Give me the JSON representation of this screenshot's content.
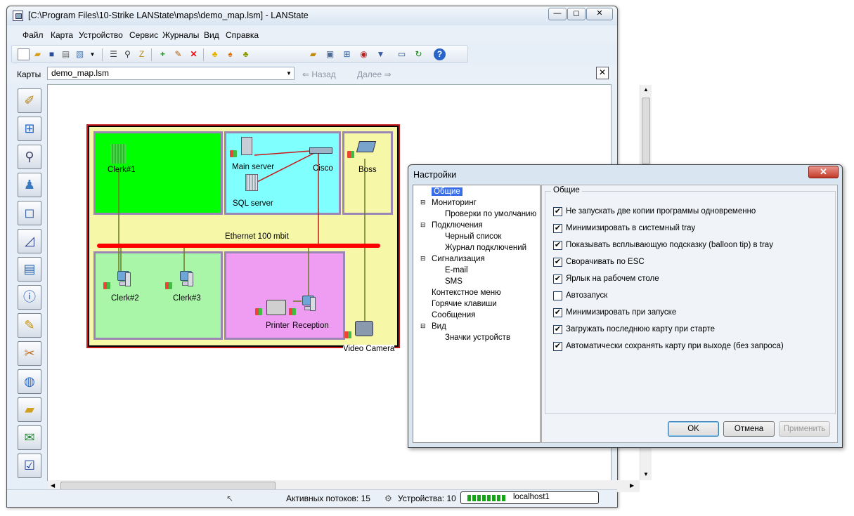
{
  "main": {
    "title": "[C:\\Program Files\\10-Strike LANState\\maps\\demo_map.lsm] - LANState",
    "window_buttons": {
      "minimize": "—",
      "restore": "◻",
      "close": "✕"
    },
    "menu": [
      "Файл",
      "Карта",
      "Устройство",
      "Сервис",
      "Журналы",
      "Вид",
      "Справка"
    ],
    "maps_label": "Карты",
    "maps_value": "demo_map.lsm",
    "back_label": "Назад",
    "forward_label": "Далее",
    "close_glyph": "✕"
  },
  "toolbar_icons": [
    "new-icon",
    "open-icon",
    "save-icon",
    "print-icon",
    "image-icon",
    "dropdown-icon",
    "list-icon",
    "find-icon",
    "zoom-icon",
    "add-icon",
    "edit-icon",
    "delete-icon",
    "bell-icon",
    "bell-alert-icon",
    "bell-ok-icon"
  ],
  "sidebar_icons": [
    "map-icon",
    "network-icon",
    "ip-scan-icon",
    "user-alert-icon",
    "square-icon",
    "polygon-icon",
    "document-icon",
    "info-icon",
    "report-icon",
    "tools-icon",
    "globe-icon",
    "folder-icon",
    "mail-icon",
    "checklist-icon"
  ],
  "map": {
    "devices": {
      "clerk1": "Clerk#1",
      "main_server": "Main server",
      "sql_server": "SQL server",
      "cisco": "Cisco",
      "boss": "Boss",
      "ethernet": "Ethernet 100 mbit",
      "clerk2": "Clerk#2",
      "clerk3": "Clerk#3",
      "printer": "Printer",
      "reception": "Reception",
      "video_camera": "Video Camera"
    },
    "colors": {
      "green_room": "#00ff00",
      "cyan_room": "#80ffff",
      "yellow": "#f7f7a8",
      "lightgreen": "#a9f6a9",
      "magenta": "#ef9cf3",
      "ethernet": "#ff0000"
    }
  },
  "status": {
    "threads": "Активных потоков: 15",
    "devices": "Устройства: 10",
    "host": "localhost1"
  },
  "settings": {
    "title": "Настройки",
    "close_glyph": "✕",
    "tree": [
      "Общие",
      "Мониторинг",
      "Проверки по умолчанию",
      "Подключения",
      "Черный список",
      "Журнал подключений",
      "Сигнализация",
      "E-mail",
      "SMS",
      "Контекстное меню",
      "Горячие клавиши",
      "Сообщения",
      "Вид",
      "Значки устройств"
    ],
    "group_title": "Общие",
    "options": [
      {
        "label": "Не запускать две копии программы одновременно",
        "checked": "✔"
      },
      {
        "label": "Минимизировать в системный tray",
        "checked": "✔"
      },
      {
        "label": "Показывать всплывающую подсказку (balloon tip) в tray",
        "checked": "✔"
      },
      {
        "label": "Сворачивать по ESC",
        "checked": "✔"
      },
      {
        "label": "Ярлык на рабочем столе",
        "checked": "✔"
      },
      {
        "label": "Автозапуск",
        "checked": ""
      },
      {
        "label": "Минимизировать при запуске",
        "checked": "✔"
      },
      {
        "label": "Загружать последнюю  карту при старте",
        "checked": "✔"
      },
      {
        "label": "Автоматически сохранять карту при выходе (без запроса)",
        "checked": "✔"
      }
    ],
    "ok": "OK",
    "cancel": "Отмена",
    "apply": "Применить"
  }
}
